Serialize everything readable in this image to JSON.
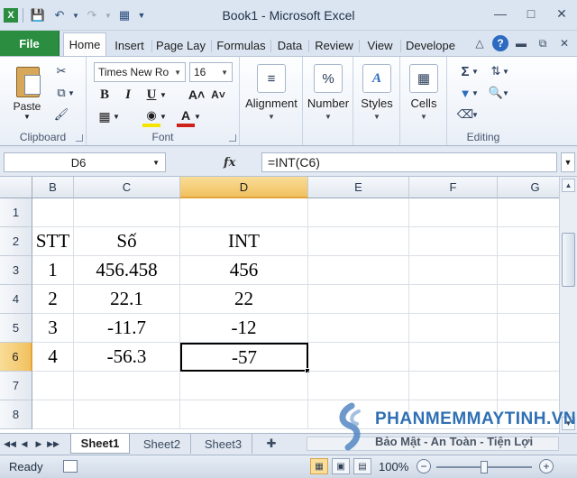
{
  "window": {
    "title": "Book1 - Microsoft Excel"
  },
  "tabs": {
    "file": "File",
    "home": "Home",
    "insert": "Insert",
    "page_layout": "Page Lay",
    "formulas": "Formulas",
    "data": "Data",
    "review": "Review",
    "view": "View",
    "developer": "Develope"
  },
  "ribbon": {
    "clipboard": {
      "label": "Clipboard",
      "paste": "Paste"
    },
    "font": {
      "label": "Font",
      "name": "Times New Ro",
      "size": "16"
    },
    "alignment": {
      "label": "Alignment"
    },
    "number": {
      "label": "Number",
      "icon_text": "%"
    },
    "styles": {
      "label": "Styles"
    },
    "cells": {
      "label": "Cells"
    },
    "editing": {
      "label": "Editing"
    }
  },
  "formula_bar": {
    "name_box": "D6",
    "fx": "fx",
    "formula": "=INT(C6)"
  },
  "grid": {
    "columns": [
      "B",
      "C",
      "D",
      "E",
      "F",
      "G"
    ],
    "selected_column": "D",
    "rows": [
      "1",
      "2",
      "3",
      "4",
      "5",
      "6",
      "7",
      "8"
    ],
    "selected_row": "6",
    "cells": {
      "B2": "STT",
      "C2": "Số",
      "D2": "INT",
      "B3": "1",
      "C3": "456.458",
      "D3": "456",
      "B4": "2",
      "C4": "22.1",
      "D4": "22",
      "B5": "3",
      "C5": "-11.7",
      "D5": "-12",
      "B6": "4",
      "C6": "-56.3",
      "D6": "-57"
    },
    "active_cell": "D6"
  },
  "sheets": [
    "Sheet1",
    "Sheet2",
    "Sheet3"
  ],
  "active_sheet": "Sheet1",
  "status": {
    "text": "Ready",
    "zoom": "100%"
  },
  "watermark": {
    "title": "PHANMEMMAYTINH.VN",
    "subtitle": "Bảo Mật - An Toàn - Tiện Lợi"
  },
  "colors": {
    "file_tab": "#2a8d3f",
    "selection_header": "#f1c15f",
    "watermark_blue": "#2f6fb3"
  },
  "icons": [
    "save-icon",
    "undo-icon",
    "redo-icon",
    "calculator-icon",
    "paste-icon",
    "cut-icon",
    "copy-icon",
    "format-painter-icon",
    "bold-icon",
    "italic-icon",
    "underline-icon",
    "increase-font-icon",
    "decrease-font-icon",
    "borders-icon",
    "fill-color-icon",
    "font-color-icon",
    "alignment-icon",
    "number-format-icon",
    "styles-icon",
    "cells-icon",
    "autosum-icon",
    "sort-filter-icon",
    "fill-icon",
    "find-select-icon",
    "clear-icon",
    "help-icon",
    "minimize-icon",
    "maximize-icon",
    "close-icon"
  ]
}
